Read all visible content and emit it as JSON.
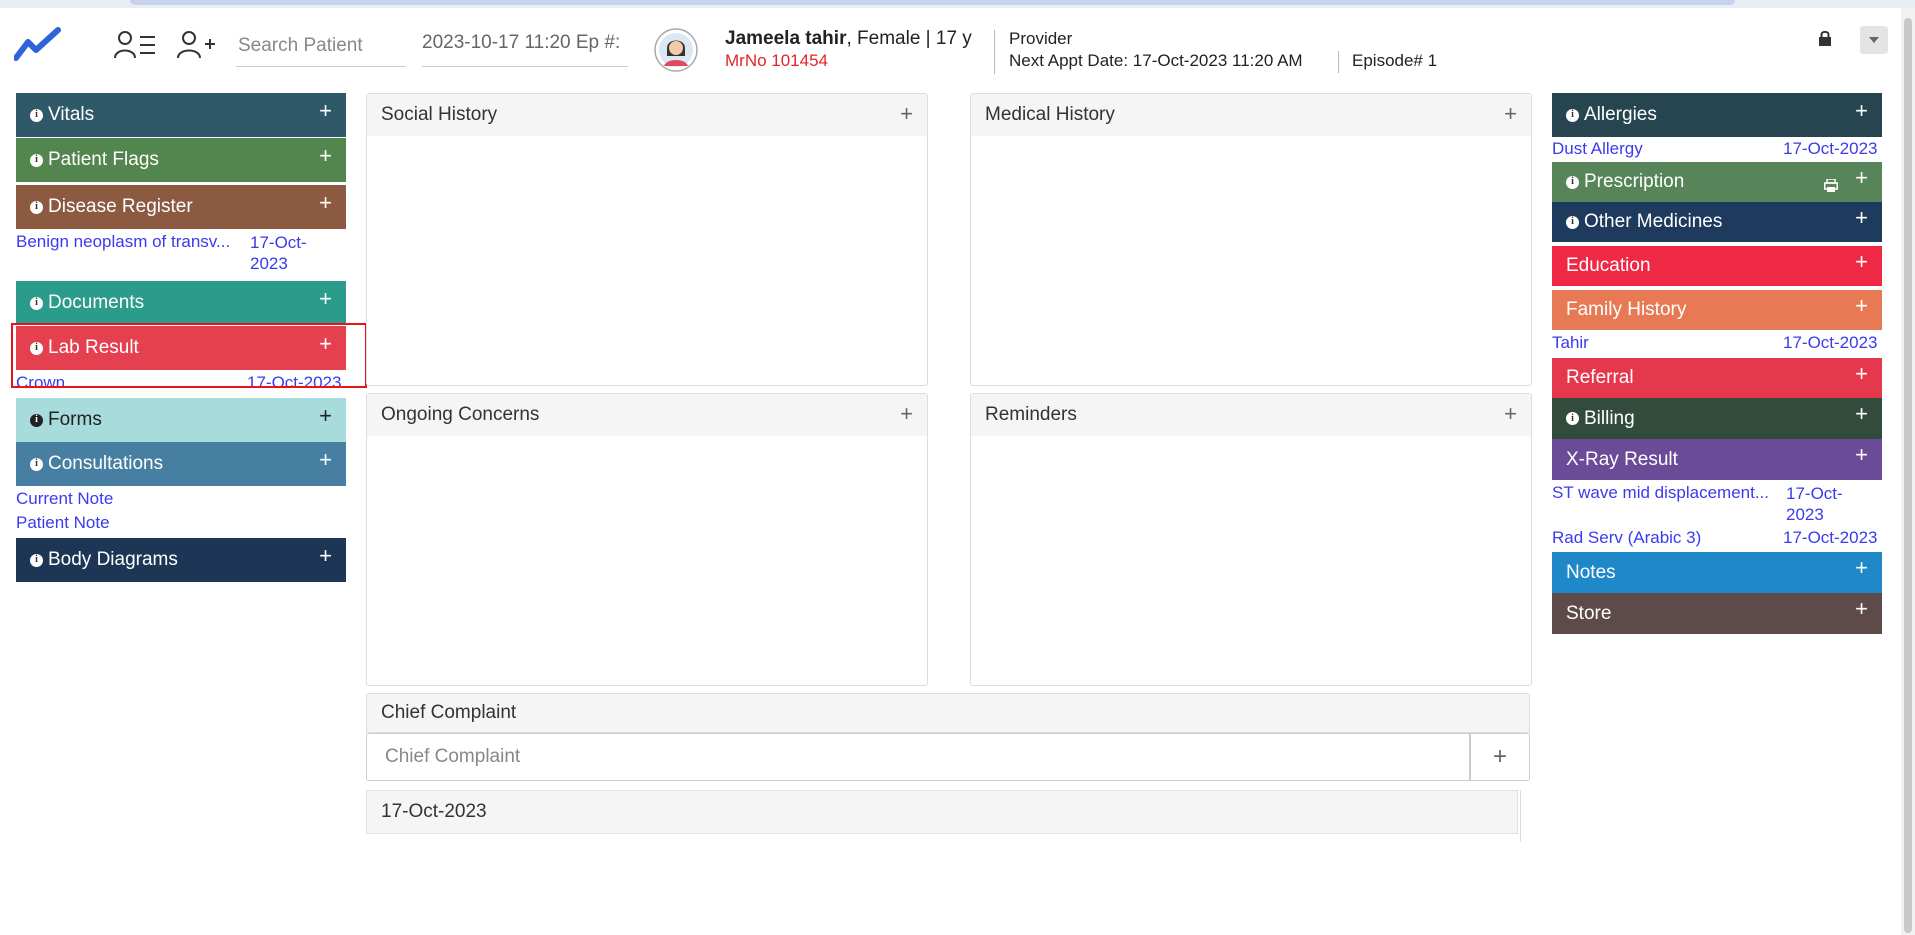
{
  "header": {
    "search_placeholder": "Search Patient",
    "episode_field": "2023-10-17 11:20 Ep #:",
    "patient_name": "Jameela tahir",
    "patient_details": ", Female | 17 y",
    "mrno": "MrNo 101454",
    "provider_label": "Provider",
    "next_appt": "Next Appt Date: 17-Oct-2023 11:20 AM",
    "episode": "Episode# 1"
  },
  "left_sidebar": {
    "vitals": "Vitals",
    "patient_flags": "Patient Flags",
    "disease_register": "Disease Register",
    "disease_item": {
      "label": "Benign neoplasm of transv...",
      "date_line1": "17-Oct-",
      "date_line2": "2023"
    },
    "documents": "Documents",
    "lab_result": "Lab Result",
    "lab_item": {
      "label": "Crown",
      "date": "17-Oct-2023"
    },
    "forms": "Forms",
    "consultations": "Consultations",
    "consult_items": [
      "Current Note",
      "Patient Note"
    ],
    "body_diagrams": "Body Diagrams"
  },
  "center": {
    "social_history": "Social History",
    "medical_history": "Medical History",
    "ongoing_concerns": "Ongoing Concerns",
    "reminders": "Reminders",
    "chief_complaint_title": "Chief Complaint",
    "chief_complaint_placeholder": "Chief Complaint",
    "date_band": "17-Oct-2023"
  },
  "right_sidebar": {
    "allergies": "Allergies",
    "allergy_item": {
      "label": "Dust Allergy",
      "date": "17-Oct-2023"
    },
    "prescription": "Prescription",
    "other_medicines": "Other Medicines",
    "education": "Education",
    "family_history": "Family History",
    "family_item": {
      "label": "Tahir",
      "date": "17-Oct-2023"
    },
    "referral": "Referral",
    "billing": "Billing",
    "xray_result": "X-Ray Result",
    "xray_items": [
      {
        "label": "ST wave mid displacement...",
        "date_line1": "17-Oct-",
        "date_line2": "2023"
      },
      {
        "label": "Rad Serv (Arabic 3)",
        "date": "17-Oct-2023"
      }
    ],
    "notes": "Notes",
    "store": "Store"
  },
  "icons": {
    "plus": "+",
    "info": "i"
  },
  "colors": {
    "vitals": "#2f5868",
    "patient_flags": "#53854f",
    "disease_register": "#8b5a41",
    "documents": "#2b9c8c",
    "lab_result": "#e5404f",
    "forms": "#a8dcdc",
    "consultations": "#467fa2",
    "body_diagrams": "#1d3655",
    "allergies": "#264550",
    "prescription": "#58845a",
    "other_medicines": "#1e3a5c",
    "education": "#ee2845",
    "family_history": "#e77a55",
    "referral": "#e6384d",
    "billing": "#334b3c",
    "xray_result": "#6b4b98",
    "notes": "#1e88c8",
    "store": "#5f4a4a",
    "link": "#3a3aee",
    "mrno": "#e02626",
    "highlight_box": "#e8141c"
  }
}
